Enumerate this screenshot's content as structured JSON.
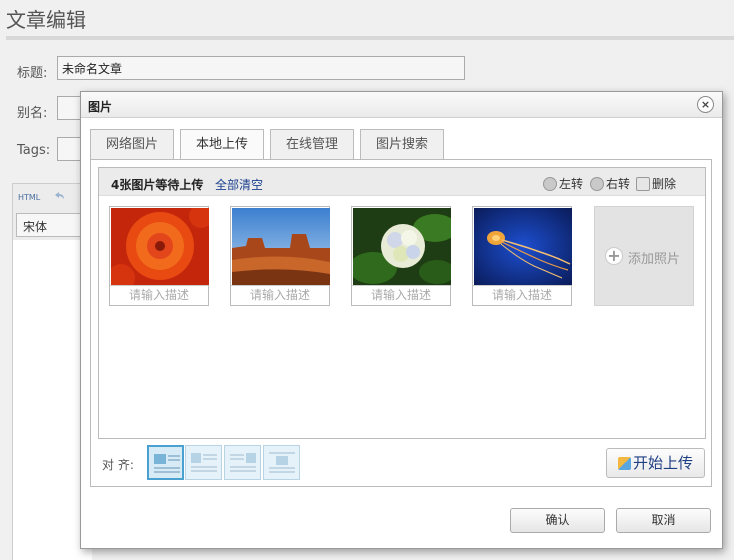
{
  "page": {
    "title": "文章编辑",
    "labels": {
      "title": "标题:",
      "alias": "别名:",
      "tags": "Tags:"
    },
    "title_value": "未命名文章",
    "html_button": "HTML",
    "font_select": "宋体"
  },
  "dialog": {
    "title": "图片",
    "close_icon": "×",
    "tabs": [
      {
        "label": "网络图片"
      },
      {
        "label": "本地上传"
      },
      {
        "label": "在线管理"
      },
      {
        "label": "图片搜索"
      }
    ],
    "active_tab": "本地上传",
    "upload": {
      "pending_text": "4张图片等待上传",
      "clear_all": "全部清空",
      "rotate_left": "左转",
      "rotate_right": "右转",
      "delete": "删除",
      "images": [
        {
          "subject": "orange flower",
          "placeholder": "请输入描述"
        },
        {
          "subject": "desert butte",
          "placeholder": "请输入描述"
        },
        {
          "subject": "hydrangea",
          "placeholder": "请输入描述"
        },
        {
          "subject": "jellyfish",
          "placeholder": "请输入描述"
        }
      ],
      "add_photo": "添加照片",
      "add_icon": "+"
    },
    "align_label": "对 齐:",
    "start_upload": "开始上传",
    "confirm": "确认",
    "cancel": "取消"
  },
  "colors": {
    "link": "#1a3f8e",
    "selected_align_border": "#4aa0cf",
    "upload_button_text": "#1f3f84"
  }
}
